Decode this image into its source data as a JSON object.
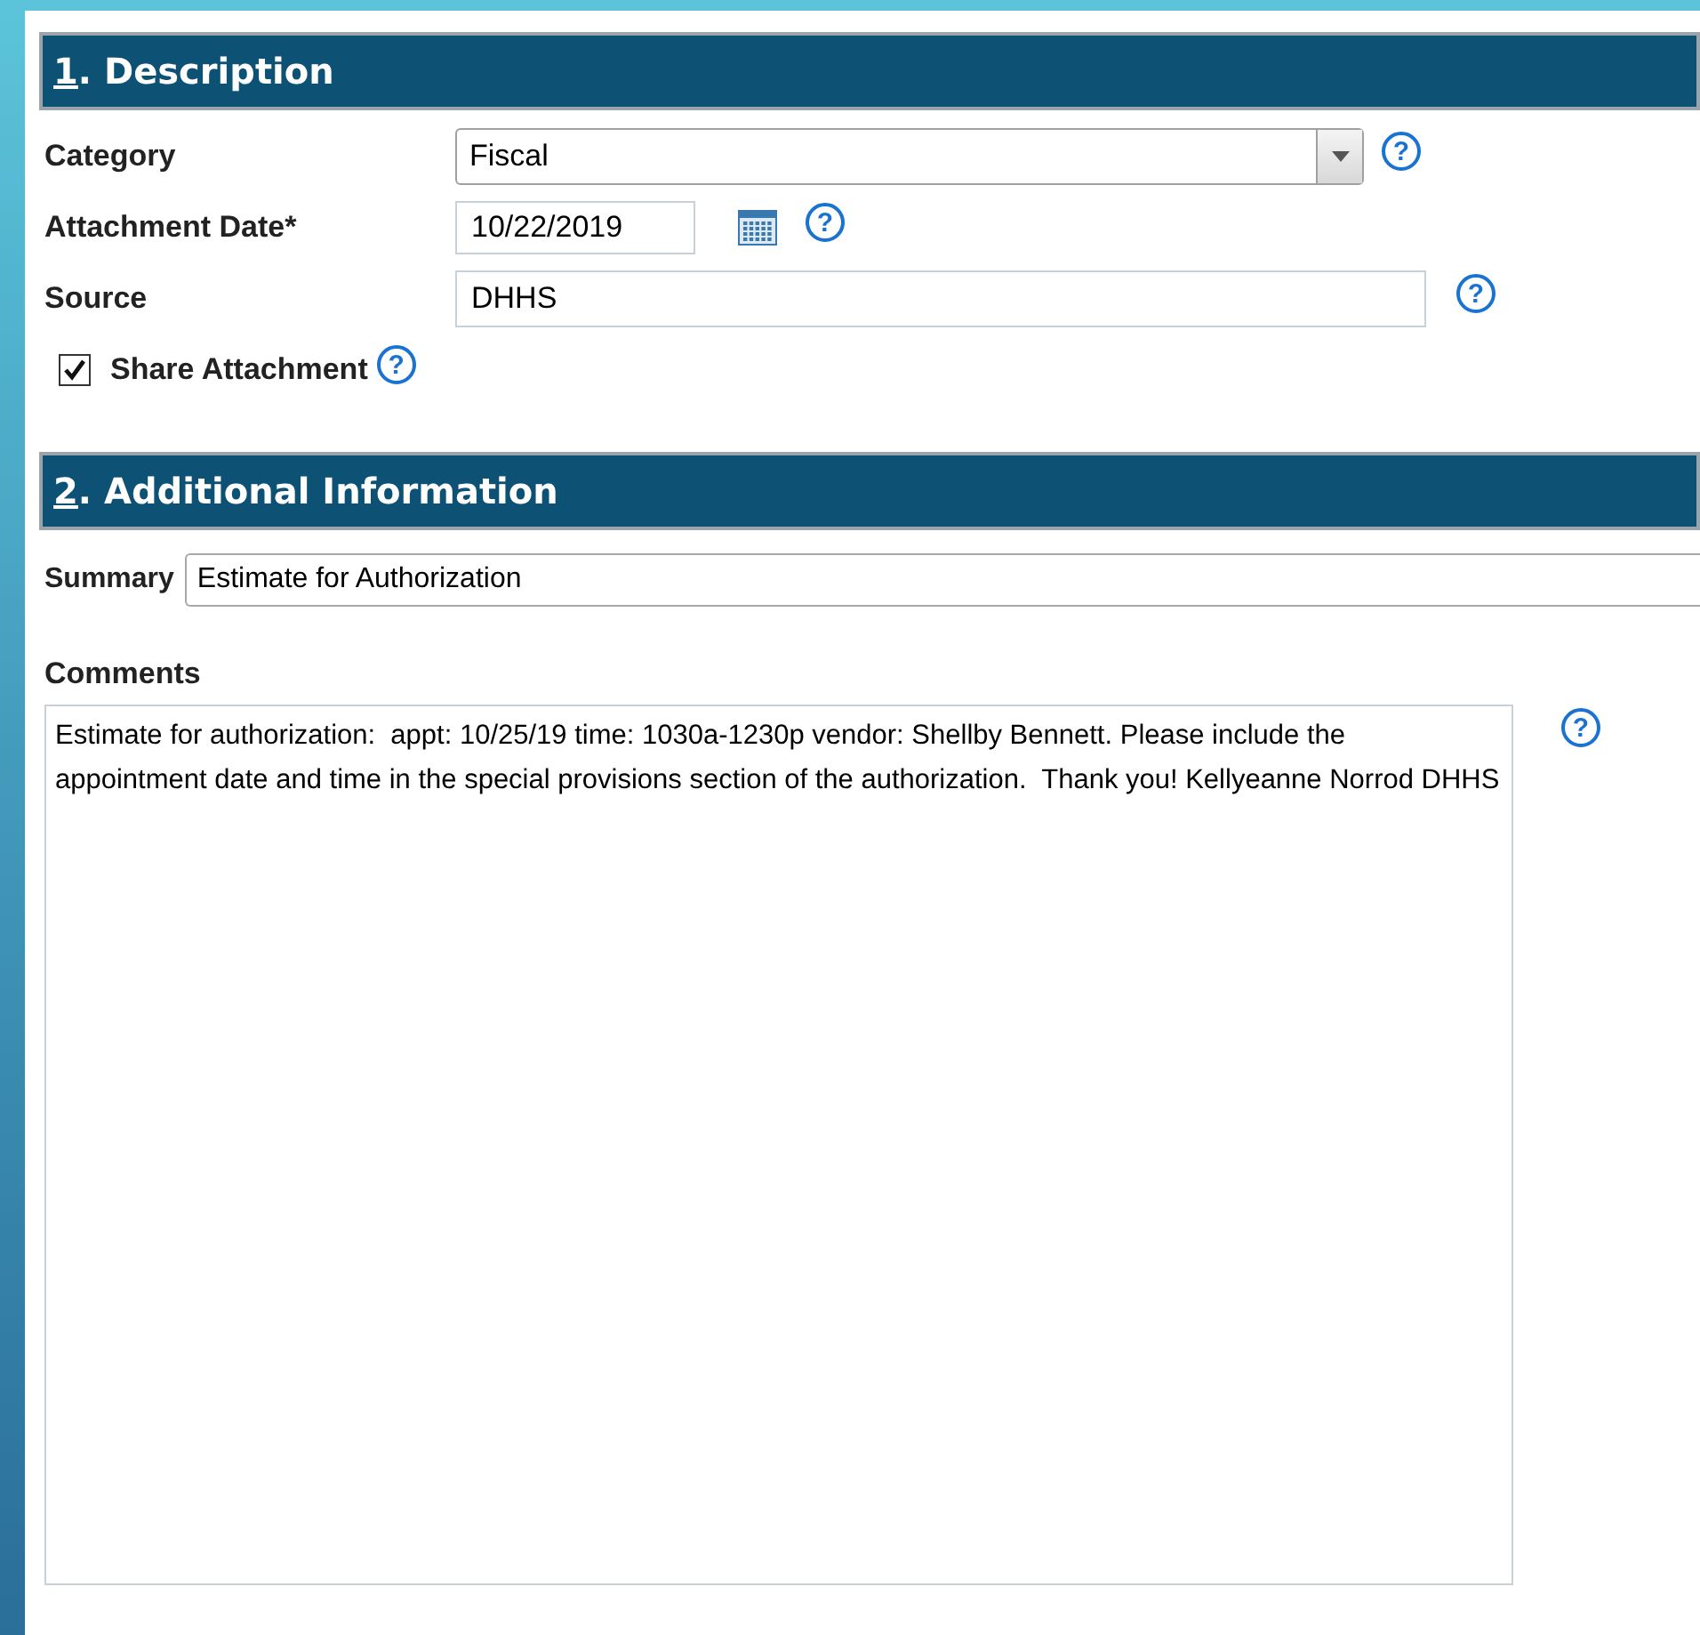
{
  "sections": [
    {
      "heading": "1. Description",
      "fields": [
        {
          "kind": "select",
          "label": "Category",
          "value": "Fiscal",
          "help": "?"
        },
        {
          "kind": "date",
          "label": "Attachment Date*",
          "value": "10/22/2019",
          "help": "?"
        },
        {
          "kind": "text",
          "label": "Source",
          "value": "DHHS",
          "help": "?"
        },
        {
          "kind": "checkbox",
          "label": "Share Attachment",
          "checked": true,
          "help": "?"
        }
      ]
    },
    {
      "heading": "2. Additional Information",
      "fields": [
        {
          "kind": "summary",
          "label": "Summary",
          "value": "Estimate for Authorization"
        },
        {
          "kind": "textarea",
          "label": "Comments",
          "value": "Estimate for authorization:  appt: 10/25/19 time: 1030a-1230p vendor: Shellby Bennett. Please include the appointment date and time in the special provisions section of the authorization.  Thank you! Kellyeanne Norrod DHHS",
          "help": "?"
        }
      ]
    }
  ]
}
